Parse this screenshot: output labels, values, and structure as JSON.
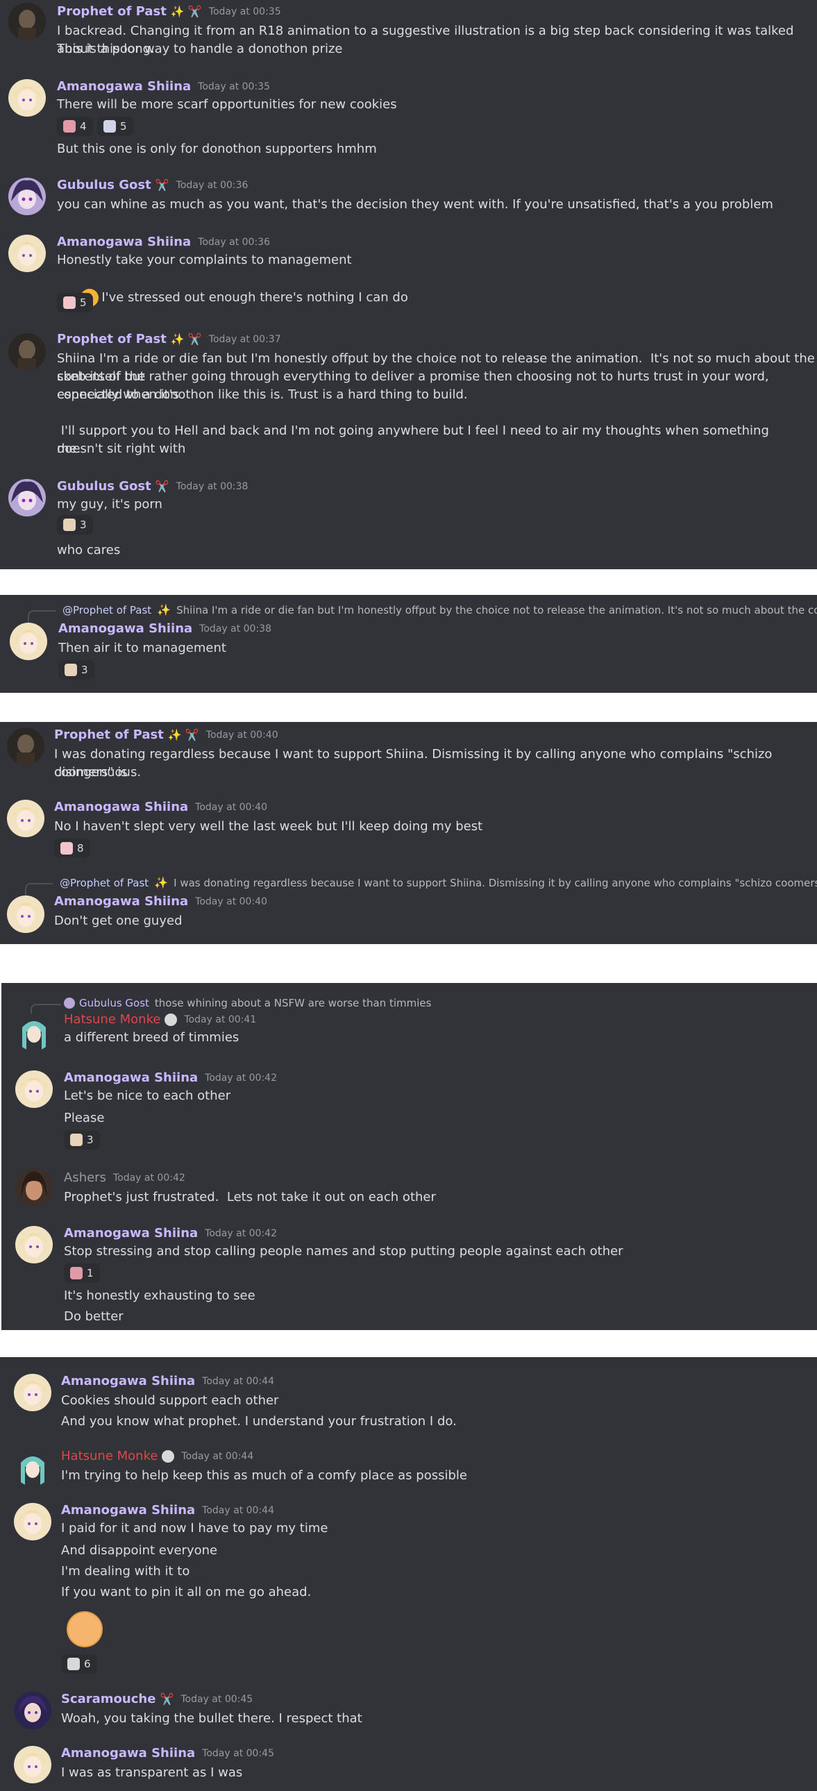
{
  "colors": {
    "background": "#313338",
    "gap": "#ffffff",
    "name_prophet": "#c9b8ff",
    "name_shiina": "#c9b8ff",
    "name_gubulus": "#c9b8ff",
    "name_hatsune": "#e0454b",
    "name_ashers": "#949ba4",
    "name_scaramouche": "#c9b8ff",
    "mention": "#c9cdfb"
  },
  "p1": {
    "m1": {
      "author": "Prophet of Past",
      "badge": "✨ ✂️",
      "time": "Today at 00:35",
      "lines": [
        "I backread. Changing it from an R18 animation to a suggestive illustration is a big step back considering it was talked about this long.",
        "This is a poor way to handle a donothon prize"
      ]
    },
    "m2": {
      "author": "Amanogawa Shiina",
      "time": "Today at 00:35",
      "line1": "There will be more scarf opportunities for new cookies",
      "r1": "4",
      "r2": "5",
      "line2": "But this one is only for donothon supporters hmhm"
    },
    "m3": {
      "author": "Gubulus Gost",
      "badge": "✂️",
      "time": "Today at 00:36",
      "line1": "you can whine as much as you want, that's the decision they went with. If you're unsatisfied, that's a you problem"
    },
    "m4": {
      "author": "Amanogawa Shiina",
      "time": "Today at 00:36",
      "line1": "Honestly take your complaints to management",
      "line2": "I've stressed out enough there's nothing I can do",
      "r1": "5"
    },
    "m5": {
      "author": "Prophet of Past",
      "badge": "✨ ✂️",
      "time": "Today at 00:37",
      "lines": [
        "Shiina I'm a ride or die fan but I'm honestly offput by the choice not to release the animation.  It's not so much about the content of the",
        "skeb itself but rather going through everything to deliver a promise then choosing not to hurts trust in your word, especially when it's",
        "connected to a donothon like this is. Trust is a hard thing to build.",
        "",
        " I'll support you to Hell and back and I'm not going anywhere but I feel I need to air my thoughts when something doesn't sit right with",
        "me."
      ]
    },
    "m6": {
      "author": "Gubulus Gost",
      "badge": "✂️",
      "time": "Today at 00:38",
      "line1": "my guy, it's porn",
      "r1": "3",
      "line2": "who cares"
    }
  },
  "p2": {
    "reply_mention": "@Prophet of Past",
    "reply_text": "Shiina I'm a ride or die fan but I'm honestly offput by the choice not to release the animation. It's not so much about the content of",
    "author": "Amanogawa Shiina",
    "time": "Today at 00:38",
    "line1": "Then air it to management",
    "r1": "3"
  },
  "p3": {
    "m1": {
      "author": "Prophet of Past",
      "badge": "✨ ✂️",
      "time": "Today at 00:40",
      "lines": [
        "I was donating regardless because I want to support Shiina. Dismissing it by calling anyone who complains \"schizo coomers\" is",
        "disingenuous."
      ]
    },
    "m2": {
      "author": "Amanogawa Shiina",
      "time": "Today at 00:40",
      "line1": "No I haven't slept very well the last week but I'll keep doing my best",
      "r1": "8"
    },
    "m3": {
      "reply_mention": "@Prophet of Past",
      "reply_text": "I was donating regardless because I want to support Shiina. Dismissing it by calling anyone who complains \"schizo coomers\" is dis",
      "author": "Amanogawa Shiina",
      "time": "Today at 00:40",
      "line1": "Don't get one guyed"
    }
  },
  "p4": {
    "m1": {
      "reply_author": "Gubulus Gost",
      "reply_text": "those whining about a NSFW are worse than timmies",
      "author": "Hatsune Monke",
      "time": "Today at 00:41",
      "line1": "a different breed of timmies"
    },
    "m2": {
      "author": "Amanogawa Shiina",
      "time": "Today at 00:42",
      "line1": "Let's be nice to each other",
      "line2": "Please",
      "r1": "3"
    },
    "m3": {
      "author": "Ashers",
      "time": "Today at 00:42",
      "line1": "Prophet's just frustrated.  Lets not take it out on each other"
    },
    "m4": {
      "author": "Amanogawa Shiina",
      "time": "Today at 00:42",
      "line1": "Stop stressing and stop calling people names and stop putting people against each other",
      "r1": "1",
      "line2": "It's honestly exhausting to see",
      "line3": "Do better"
    }
  },
  "p5": {
    "m1": {
      "author": "Amanogawa Shiina",
      "time": "Today at 00:44",
      "line1": "Cookies should support each other",
      "line2": "And you know what prophet. I understand your frustration I do."
    },
    "m2": {
      "author": "Hatsune Monke",
      "time": "Today at 00:44",
      "line1": "I'm trying to help keep this as much of a comfy place as possible"
    },
    "m3": {
      "author": "Amanogawa Shiina",
      "time": "Today at 00:44",
      "lines": [
        "I paid for it and now I have to pay my time",
        "And disappoint everyone",
        "I'm dealing with it to",
        "If you want to pin it all on me go ahead."
      ],
      "r1": "6"
    },
    "m4": {
      "author": "Scaramouche",
      "badge": "✂️",
      "time": "Today at 00:45",
      "line1": "Woah, you taking the bullet there. I respect that"
    },
    "m5": {
      "author": "Amanogawa Shiina",
      "time": "Today at 00:45",
      "line1": "I was as transparent as I was"
    }
  }
}
